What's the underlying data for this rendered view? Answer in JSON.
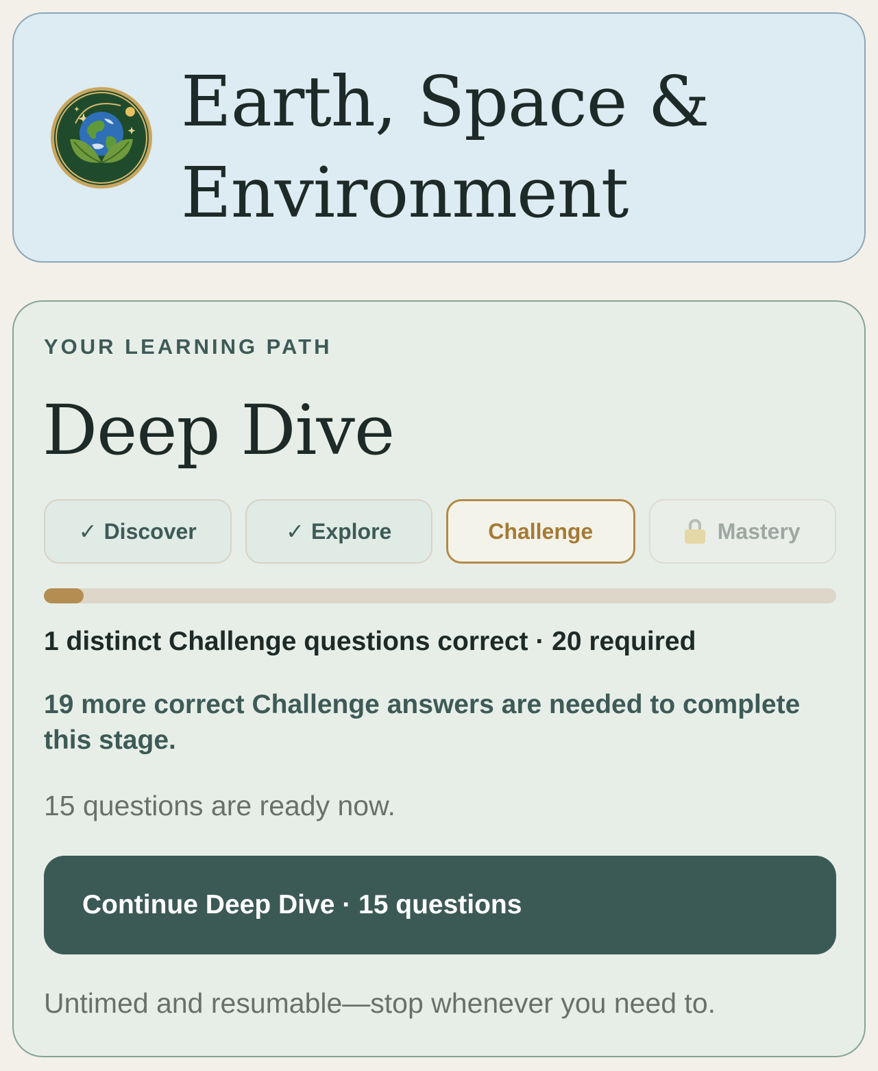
{
  "subject": {
    "title": "Earth, Space & Environment",
    "badge_icon": "earth-leaves-badge-icon"
  },
  "learning_path": {
    "eyebrow": "YOUR LEARNING PATH",
    "title": "Deep Dive",
    "stages": [
      {
        "label": "Discover",
        "status": "complete",
        "icon": "checkmark-icon",
        "mark": "✓"
      },
      {
        "label": "Explore",
        "status": "complete",
        "icon": "checkmark-icon",
        "mark": "✓"
      },
      {
        "label": "Challenge",
        "status": "current"
      },
      {
        "label": "Mastery",
        "status": "locked",
        "icon": "lock-icon"
      }
    ],
    "progress": {
      "correct": 1,
      "required": 20,
      "fraction": 0.05
    },
    "count_text": "1 distinct Challenge questions correct · 20 required",
    "needed_text": "19 more correct Challenge answers are needed to complete this stage.",
    "ready_text": "15 questions are ready now.",
    "continue_label": "Continue Deep Dive · 15 questions",
    "footnote": "Untimed and resumable—stop whenever you need to."
  },
  "colors": {
    "page_background": "#f3f0ea",
    "header_background": "#ddebf2",
    "card_background": "#e7eee8",
    "primary": "#3c5a55",
    "accent": "#b38d52"
  }
}
